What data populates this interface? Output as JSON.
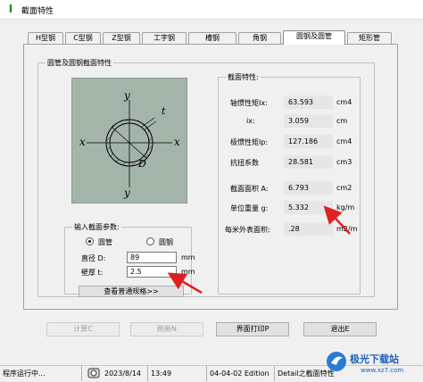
{
  "window": {
    "title": "截面特性",
    "icon": "I"
  },
  "tabs": [
    {
      "label": "H型钢",
      "active": false
    },
    {
      "label": "C型钢",
      "active": false
    },
    {
      "label": "Z型钢",
      "active": false
    },
    {
      "label": "工字钢",
      "active": false
    },
    {
      "label": "槽钢",
      "active": false
    },
    {
      "label": "角钢",
      "active": false
    },
    {
      "label": "圆钢及圆管",
      "active": true
    },
    {
      "label": "矩形管",
      "active": false
    }
  ],
  "section_group": {
    "label": "圆管及圆钢截面特性"
  },
  "figure": {
    "axis_labels": {
      "x_left": "x",
      "x_right": "x",
      "y_top": "y",
      "y_bottom": "y",
      "thickness": "t",
      "diameter": "D"
    },
    "background": "#a3b5a8"
  },
  "input_group": {
    "label": "输入截面参数:",
    "type_pipe": "圆管",
    "type_bar": "圆钢",
    "selected": "圆管",
    "diameter_label": "直径 D:",
    "diameter_value": "89",
    "diameter_unit": "mm",
    "thickness_label": "壁厚 t:",
    "thickness_value": "2.5",
    "thickness_unit": "mm",
    "spec_button": "查看普通规格>>"
  },
  "properties_group": {
    "label": "截面特性:",
    "rows": [
      {
        "label": "轴惯性矩Ix:",
        "value": "63.593",
        "unit": "cm4"
      },
      {
        "label": "ix:",
        "value": "3.059",
        "unit": "cm"
      },
      {
        "label": "极惯性矩Ip:",
        "value": "127.186",
        "unit": "cm4"
      },
      {
        "label": "抗扭系数",
        "value": "28.581",
        "unit": "cm3"
      },
      {
        "label": "截面面积 A:",
        "value": "6.793",
        "unit": "cm2"
      },
      {
        "label": "单位重量 g:",
        "value": "5.332",
        "unit": "kg/m"
      },
      {
        "label": "每米外表面积:",
        "value": ".28",
        "unit": "m2/m"
      }
    ]
  },
  "buttons": {
    "calculate": "计算C",
    "refresh": "刷新N",
    "print": "界面打印P",
    "exit": "退出E"
  },
  "status": {
    "running": "程序运行中...",
    "date": "2023/8/14",
    "time": "13:49",
    "edition": "04-04-02 Edition",
    "detail": "Detail之截面特性"
  },
  "watermark": {
    "brand": "极光下载站",
    "url": "www.xz7.com"
  },
  "colors": {
    "annotation_arrow": "#e02020",
    "figure_bg": "#a3b5a8"
  }
}
